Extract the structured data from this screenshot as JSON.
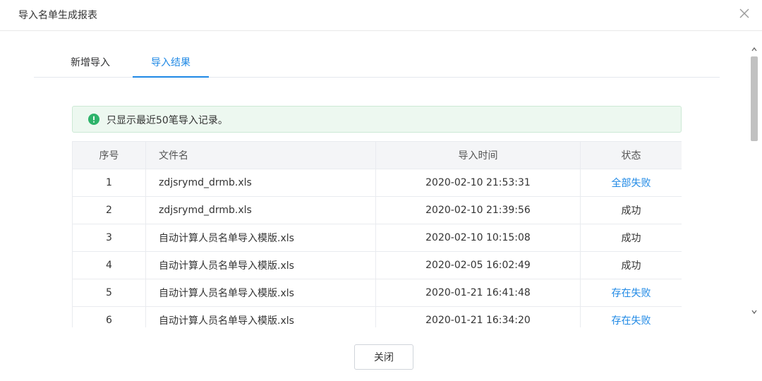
{
  "dialog": {
    "title": "导入名单生成报表"
  },
  "tabs": [
    {
      "label": "新增导入",
      "active": false
    },
    {
      "label": "导入结果",
      "active": true
    }
  ],
  "alert": {
    "icon": "info-circle-icon",
    "text": "只显示最近50笔导入记录。",
    "color": "#2db36a"
  },
  "table": {
    "columns": [
      "序号",
      "文件名",
      "导入时间",
      "状态"
    ],
    "rows": [
      {
        "index": "1",
        "file": "zdjsrymd_drmb.xls",
        "time": "2020-02-10 21:53:31",
        "status": "全部失败",
        "status_link": true
      },
      {
        "index": "2",
        "file": "zdjsrymd_drmb.xls",
        "time": "2020-02-10 21:39:56",
        "status": "成功",
        "status_link": false
      },
      {
        "index": "3",
        "file": "自动计算人员名单导入模版.xls",
        "time": "2020-02-10 10:15:08",
        "status": "成功",
        "status_link": false
      },
      {
        "index": "4",
        "file": "自动计算人员名单导入模版.xls",
        "time": "2020-02-05 16:02:49",
        "status": "成功",
        "status_link": false
      },
      {
        "index": "5",
        "file": "自动计算人员名单导入模版.xls",
        "time": "2020-01-21 16:41:48",
        "status": "存在失败",
        "status_link": true
      },
      {
        "index": "6",
        "file": "自动计算人员名单导入模版.xls",
        "time": "2020-01-21 16:34:20",
        "status": "存在失败",
        "status_link": true
      }
    ]
  },
  "footer": {
    "close_label": "关闭"
  },
  "colors": {
    "accent": "#1e88e5",
    "success": "#2db36a"
  }
}
